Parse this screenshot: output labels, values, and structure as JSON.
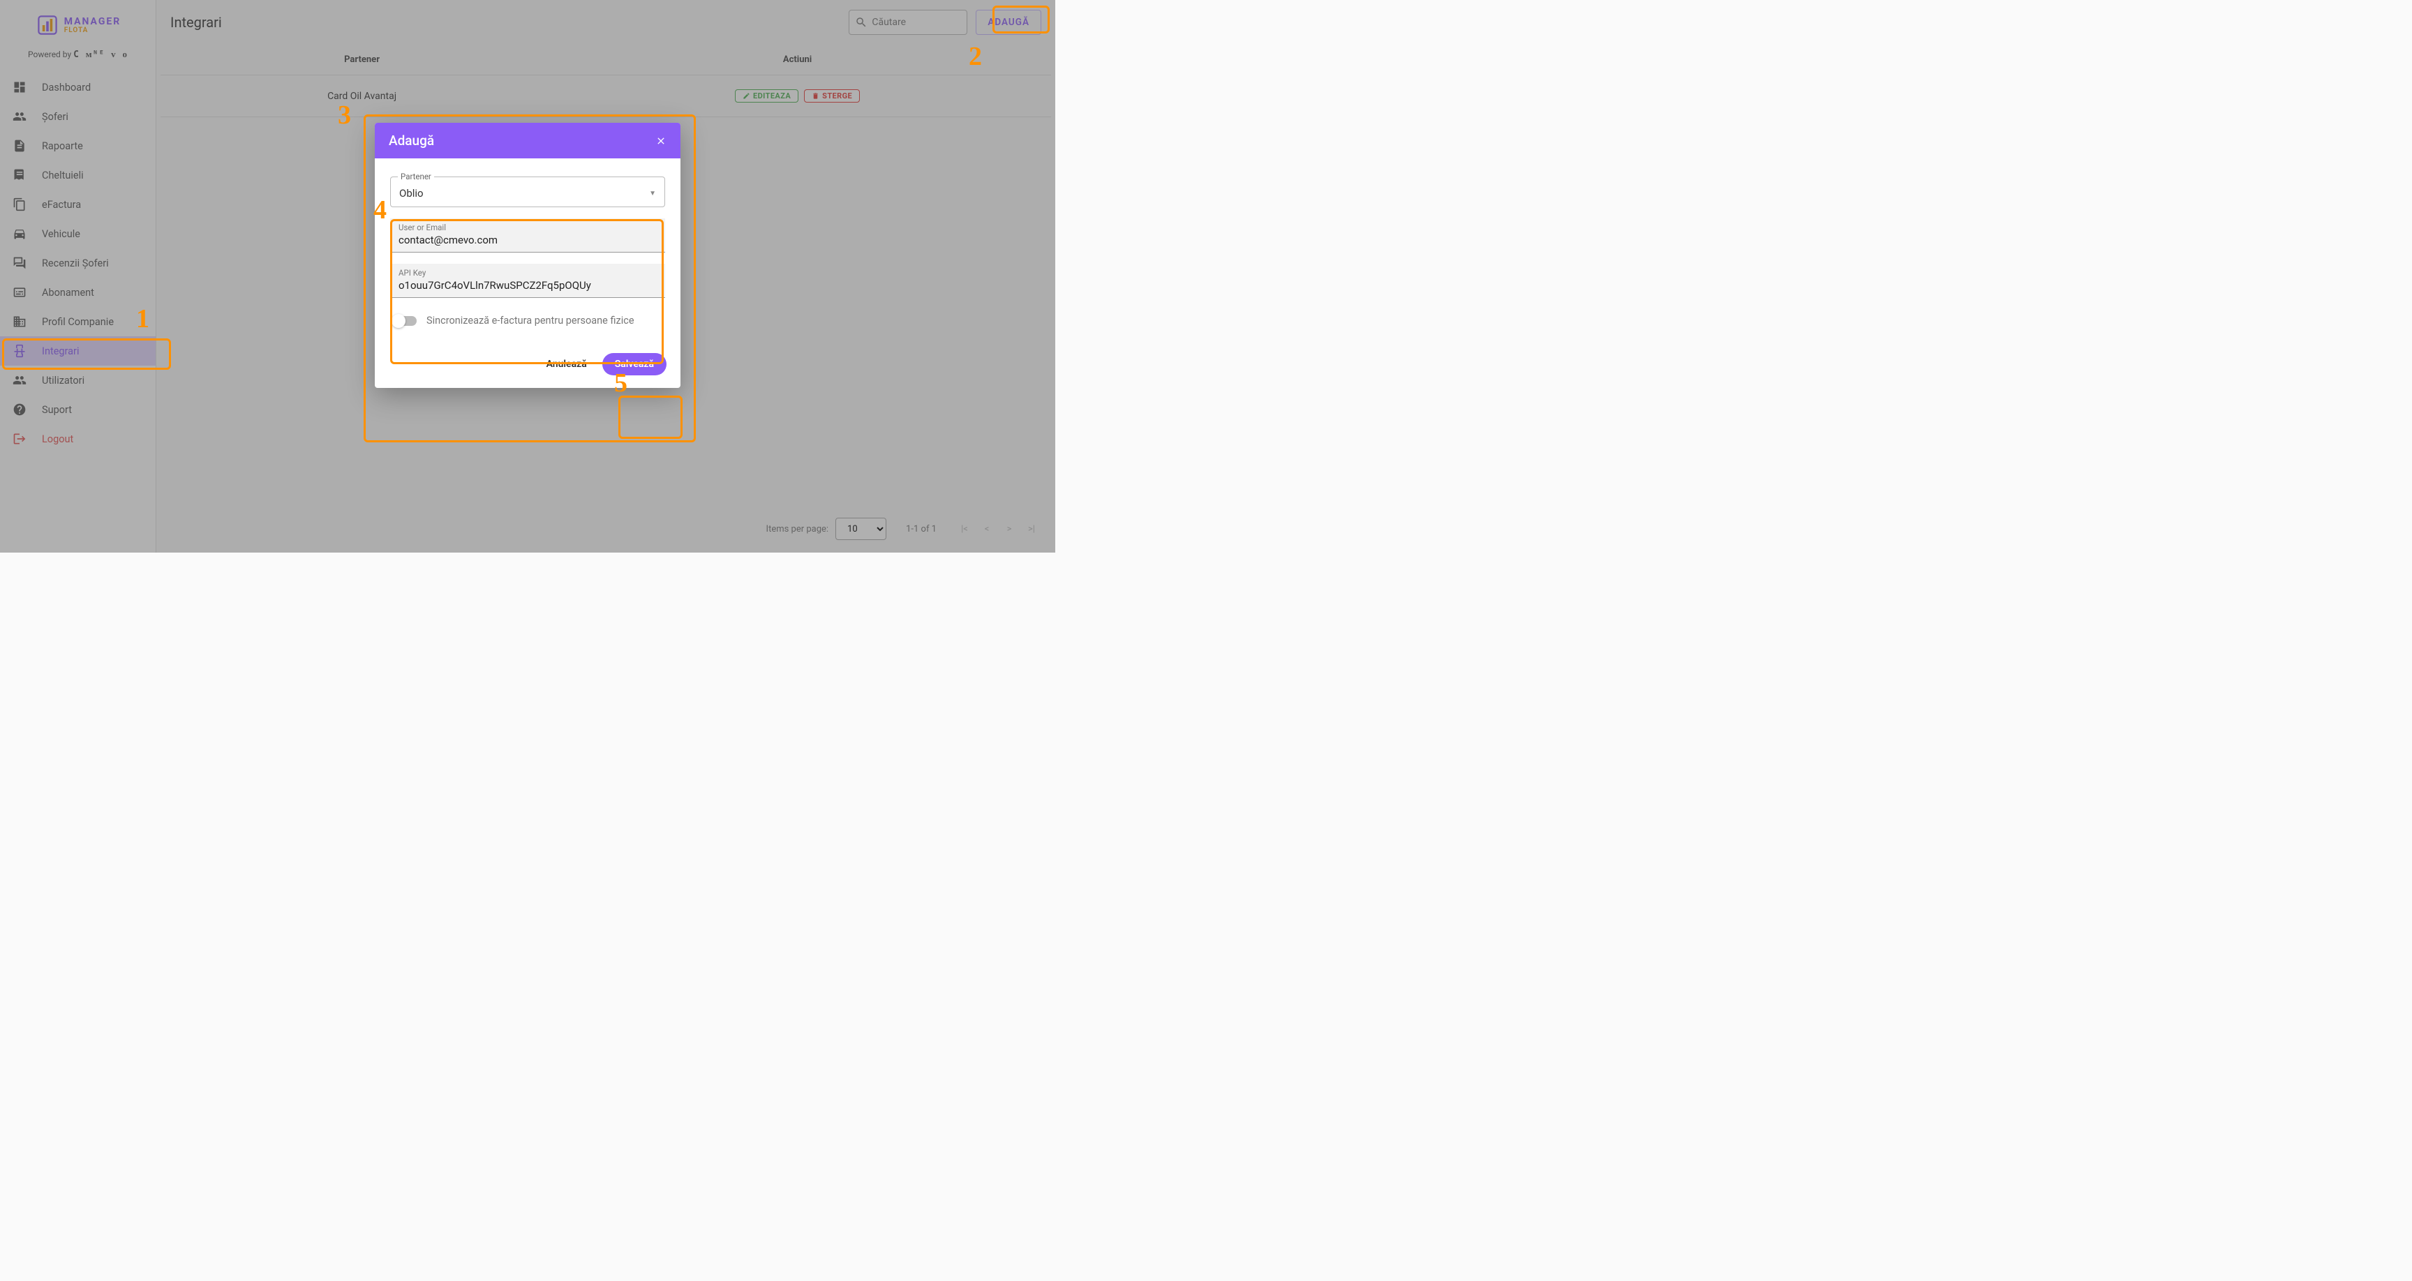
{
  "app": {
    "logo_manager": "MANAGER",
    "logo_flota": "FLOTA",
    "powered_by": "Powered by",
    "powered_brand": "С ᴍᴺᴱ ᴠ ᴏ"
  },
  "sidebar": {
    "items": [
      {
        "label": "Dashboard",
        "icon": "dashboard"
      },
      {
        "label": "Șoferi",
        "icon": "people"
      },
      {
        "label": "Rapoarte",
        "icon": "document"
      },
      {
        "label": "Cheltuieli",
        "icon": "receipt"
      },
      {
        "label": "eFactura",
        "icon": "file-copy"
      },
      {
        "label": "Vehicule",
        "icon": "car"
      },
      {
        "label": "Recenzii Șoferi",
        "icon": "reviews"
      },
      {
        "label": "Abonament",
        "icon": "subscription"
      },
      {
        "label": "Profil Companie",
        "icon": "building"
      },
      {
        "label": "Integrari",
        "icon": "integrations"
      },
      {
        "label": "Utilizatori",
        "icon": "users"
      },
      {
        "label": "Suport",
        "icon": "support"
      },
      {
        "label": "Logout",
        "icon": "logout"
      }
    ],
    "active_index": 9
  },
  "page": {
    "title": "Integrari",
    "search_placeholder": "Căutare",
    "add_button": "ADAUGĂ"
  },
  "table": {
    "columns": {
      "partner": "Partener",
      "actions": "Actiuni"
    },
    "rows": [
      {
        "partner": "Card Oil Avantaj"
      }
    ],
    "action_labels": {
      "edit": "EDITEAZA",
      "delete": "STERGE"
    }
  },
  "pagination": {
    "items_per_page_label": "Items per page:",
    "page_size": "10",
    "range": "1-1 of 1"
  },
  "modal": {
    "title": "Adaugă",
    "fields": {
      "partner_label": "Partener",
      "partner_value": "Oblio",
      "user_email_label": "User or Email",
      "user_email_value": "contact@cmevo.com",
      "api_key_label": "API Key",
      "api_key_value": "o1ouu7GrC4oVLln7RwuSPCZ2Fq5pOQUy",
      "sync_label": "Sincronizează e-factura pentru persoane fizice"
    },
    "actions": {
      "cancel": "Anulează",
      "save": "Salvează"
    }
  },
  "annotations": {
    "n1": "1",
    "n2": "2",
    "n3": "3",
    "n4": "4",
    "n5": "5"
  }
}
